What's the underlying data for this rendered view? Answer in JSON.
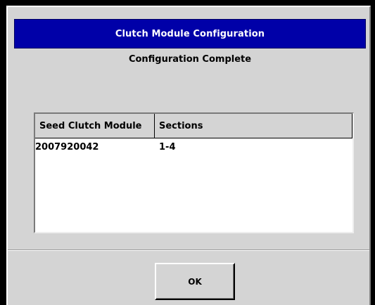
{
  "dialog": {
    "title": "Clutch Module Configuration",
    "status_text": "Configuration Complete"
  },
  "table": {
    "headers": [
      "Seed Clutch Module",
      "Sections"
    ],
    "rows": [
      [
        "2007920042",
        "1-4"
      ]
    ]
  },
  "buttons": {
    "ok_label": "OK"
  },
  "colors": {
    "titlebar": "#0000a8",
    "dialog_bg": "#d4d4d4",
    "screen_bg": "#000000"
  }
}
